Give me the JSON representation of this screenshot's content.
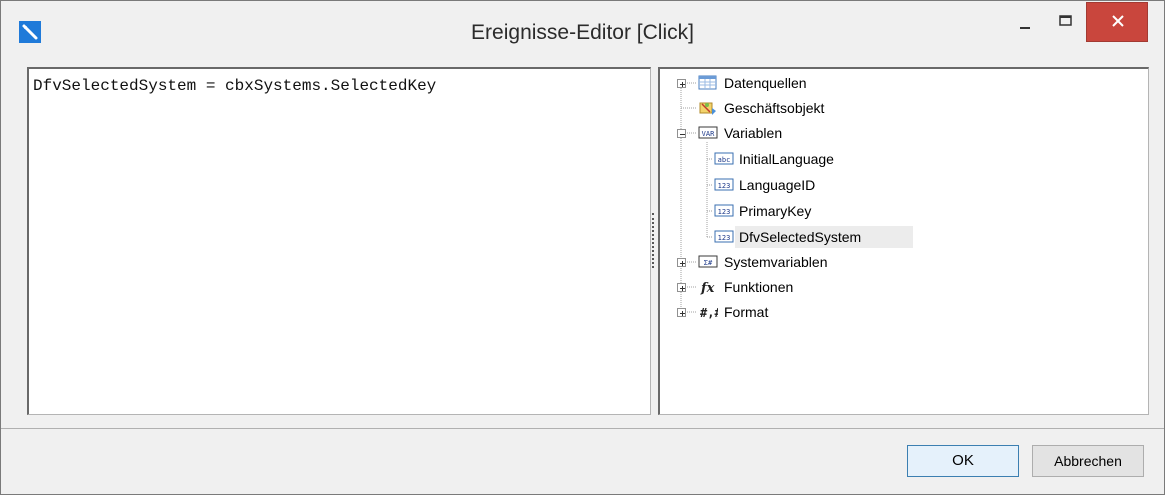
{
  "window": {
    "title": "Ereignisse-Editor [Click]",
    "controls": {
      "minimize_icon": "minimize-icon",
      "maximize_icon": "maximize-icon",
      "close_icon": "close-icon"
    }
  },
  "editor": {
    "code": "DfvSelectedSystem = cbxSystems.SelectedKey"
  },
  "tree": {
    "nodes": [
      {
        "label": "Datenquellen",
        "icon": "table-icon",
        "expander": "plus"
      },
      {
        "label": "Geschäftsobjekt",
        "icon": "business-object-icon",
        "expander": "none"
      },
      {
        "label": "Variablen",
        "icon": "variables-icon",
        "expander": "minus"
      },
      {
        "label": "InitialLanguage",
        "icon": "string-variable-icon",
        "expander": "none"
      },
      {
        "label": "LanguageID",
        "icon": "number-variable-icon",
        "expander": "none"
      },
      {
        "label": "PrimaryKey",
        "icon": "number-variable-icon",
        "expander": "none"
      },
      {
        "label": "DfvSelectedSystem",
        "icon": "number-variable-icon",
        "expander": "none",
        "selected": true
      },
      {
        "label": "Systemvariablen",
        "icon": "system-variables-icon",
        "expander": "plus"
      },
      {
        "label": "Funktionen",
        "icon": "function-icon",
        "expander": "plus"
      },
      {
        "label": "Format",
        "icon": "format-icon",
        "expander": "plus"
      }
    ]
  },
  "buttons": {
    "ok": "OK",
    "cancel": "Abbrechen"
  },
  "colors": {
    "close_button": "#c9463d",
    "app_icon": "#1f7ad9",
    "ok_border": "#3c7fb1",
    "selection": "#ececec"
  }
}
